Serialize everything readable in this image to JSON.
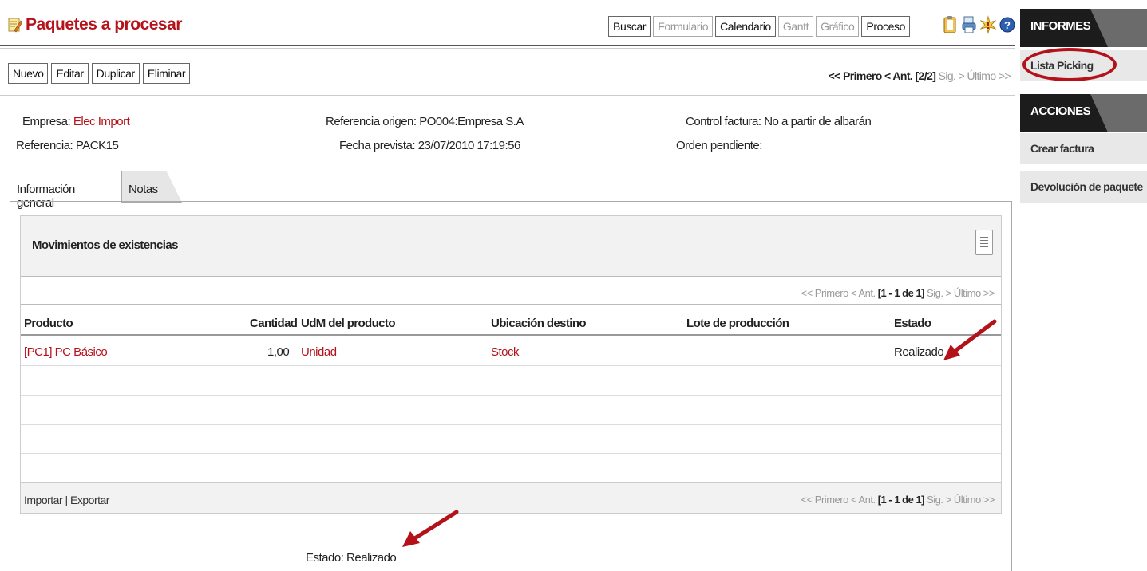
{
  "header": {
    "title": "Paquetes a procesar",
    "views": [
      {
        "label": "Buscar",
        "enabled": true
      },
      {
        "label": "Formulario",
        "enabled": false
      },
      {
        "label": "Calendario",
        "enabled": true
      },
      {
        "label": "Gantt",
        "enabled": false
      },
      {
        "label": "Gráfico",
        "enabled": false
      },
      {
        "label": "Proceso",
        "enabled": true
      }
    ],
    "icons": [
      "clipboard-icon",
      "print-icon",
      "star-burst-icon",
      "help-icon"
    ]
  },
  "toolbar": {
    "new_label": "Nuevo",
    "edit_label": "Editar",
    "duplicate_label": "Duplicar",
    "delete_label": "Eliminar",
    "pager": {
      "first": "<< Primero",
      "prev": "< Ant.",
      "position": "[2/2]",
      "next": "Sig. >",
      "last": "Último >>"
    }
  },
  "fields": {
    "empresa": {
      "label": "Empresa:",
      "value": "Elec Import"
    },
    "referencia": {
      "label": "Referencia:",
      "value": "PACK15"
    },
    "referencia_origen": {
      "label": "Referencia origen:",
      "value": "PO004:Empresa S.A"
    },
    "fecha_prevista": {
      "label": "Fecha prevista:",
      "value": "23/07/2010 17:19:56"
    },
    "control_factura": {
      "label": "Control factura:",
      "value": "No a partir de albarán"
    },
    "orden_pendiente": {
      "label": "Orden pendiente:",
      "value": ""
    }
  },
  "tabs": [
    {
      "label": "Información general",
      "active": true
    },
    {
      "label": "Notas",
      "active": false
    }
  ],
  "grid": {
    "title": "Movimientos de existencias",
    "pager": {
      "first": "<< Primero",
      "prev": "< Ant.",
      "range": "[1 - 1 de 1]",
      "next": "Sig. >",
      "last": "Último >>"
    },
    "columns": [
      "Producto",
      "Cantidad",
      "UdM del producto",
      "Ubicación destino",
      "Lote de producción",
      "Estado"
    ],
    "rows": [
      {
        "producto": "[PC1] PC Básico",
        "cantidad": "1,00",
        "udm": "Unidad",
        "ubicacion": "Stock",
        "lote": "",
        "estado": "Realizado"
      }
    ],
    "import_export": "Importar | Exportar"
  },
  "estado": {
    "label": "Estado:",
    "value": "Realizado"
  },
  "sidebar": {
    "informes_title": "INFORMES",
    "informes": [
      "Lista Picking"
    ],
    "acciones_title": "ACCIONES",
    "acciones": [
      "Crear factura",
      "Devolución de paquete"
    ]
  },
  "colors": {
    "brand": "#b5121b",
    "annotation": "#b3121a"
  }
}
